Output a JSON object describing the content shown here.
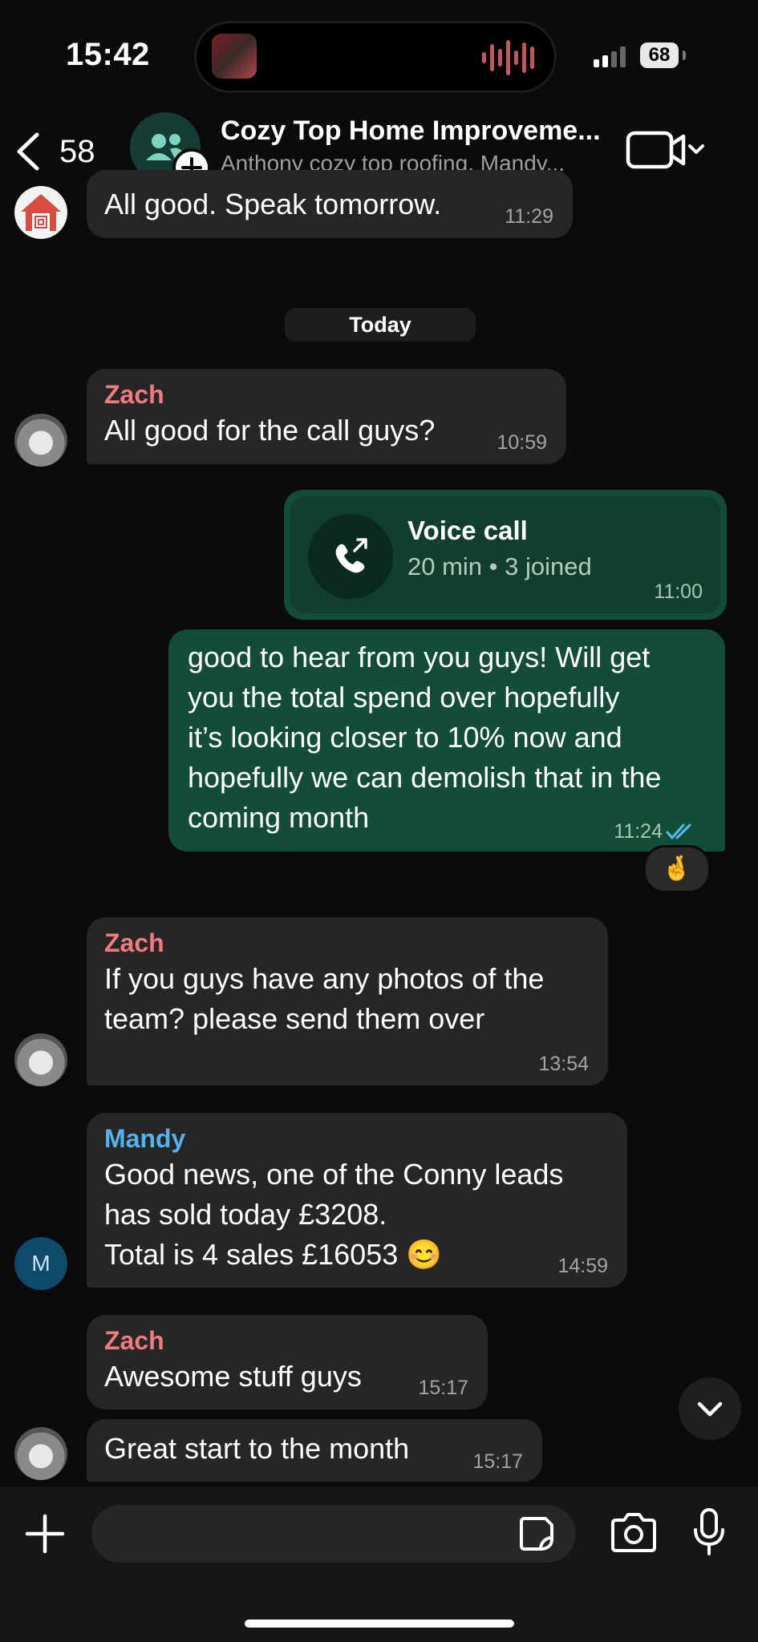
{
  "status_bar": {
    "time": "15:42",
    "battery": "68"
  },
  "header": {
    "back_count": "58",
    "title": "Cozy Top Home Improveme...",
    "subtitle": "Anthony cozy top roofing, Mandy..."
  },
  "date_divider": "Today",
  "messages": [
    {
      "direction": "in",
      "text": "All good. Speak tomorrow.",
      "time": "11:29"
    },
    {
      "direction": "in",
      "sender": "Zach",
      "text": "All good for the call guys?",
      "time": "10:59"
    },
    {
      "direction": "out",
      "type": "voice_call",
      "title": "Voice call",
      "details": "20 min • 3 joined",
      "time": "11:00"
    },
    {
      "direction": "out",
      "lines": [
        "good to hear from you guys! Will get",
        "you the total spend over hopefully",
        "it’s looking closer to 10% now and",
        "hopefully we can demolish that in the",
        "coming month"
      ],
      "time": "11:24",
      "reaction": "🤞"
    },
    {
      "direction": "in",
      "sender": "Zach",
      "lines": [
        "If you guys have any photos of the",
        "team? please send them over"
      ],
      "time": "13:54"
    },
    {
      "direction": "in",
      "sender": "Mandy",
      "avatar_letter": "M",
      "lines": [
        "Good news, one of the Conny leads",
        "has sold today £3208.",
        "Total is 4 sales £16053 😊"
      ],
      "time": "14:59"
    },
    {
      "direction": "in",
      "sender": "Zach",
      "text": "Awesome stuff guys",
      "time": "15:17"
    },
    {
      "direction": "in",
      "text": "Great start to the month",
      "time": "15:17"
    }
  ],
  "colors": {
    "background": "#0b0b0b",
    "incoming_bubble": "#262626",
    "outgoing_bubble": "#144d37",
    "sender_zach": "#f07a80",
    "sender_mandy": "#53b3ee",
    "read_ticks": "#53bdeb"
  },
  "icons": {
    "back": "chevron-left-icon",
    "group": "group-icon",
    "video": "video-camera-icon",
    "call": "outgoing-call-icon",
    "scroll": "chevron-down-icon",
    "attach": "plus-icon",
    "sticker": "sticker-icon",
    "camera": "camera-icon",
    "mic": "microphone-icon"
  }
}
